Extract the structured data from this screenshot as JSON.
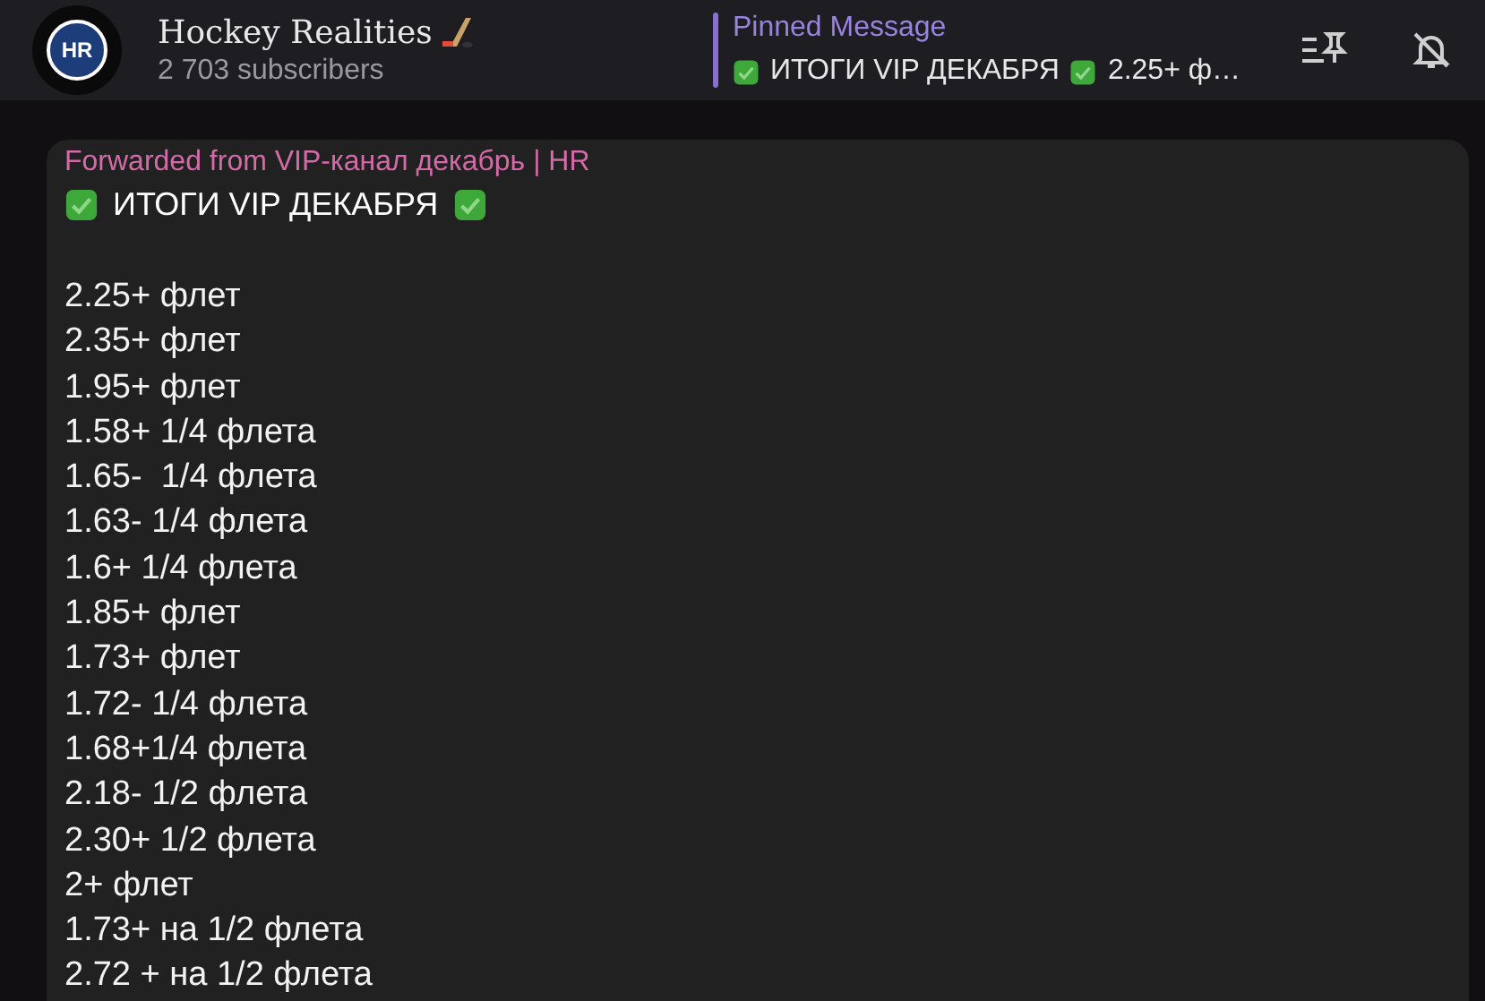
{
  "header": {
    "avatar_text": "HR",
    "title": "Hockey Realities",
    "subtitle": "2 703 subscribers"
  },
  "pinned": {
    "label": "Pinned Message",
    "text_1": "ИТОГИ VIP ДЕКАБРЯ",
    "text_2": "2.25+ ф…"
  },
  "message": {
    "forwarded": "Forwarded from VIP-канал декабрь | HR",
    "title": "ИТОГИ VIP ДЕКАБРЯ",
    "lines": [
      "2.25+ флет",
      "2.35+ флет",
      "1.95+ флет",
      "1.58+ 1/4 флета",
      "1.65-  1/4 флета",
      "1.63- 1/4 флета",
      "1.6+ 1/4 флета",
      "1.85+ флет",
      "1.73+ флет",
      "1.72- 1/4 флета",
      "1.68+1/4 флета",
      "2.18- 1/2 флета",
      "2.30+ 1/2 флета",
      "2+ флет",
      "1.73+ на 1/2 флета",
      "2.72 + на 1/2 флета"
    ]
  }
}
